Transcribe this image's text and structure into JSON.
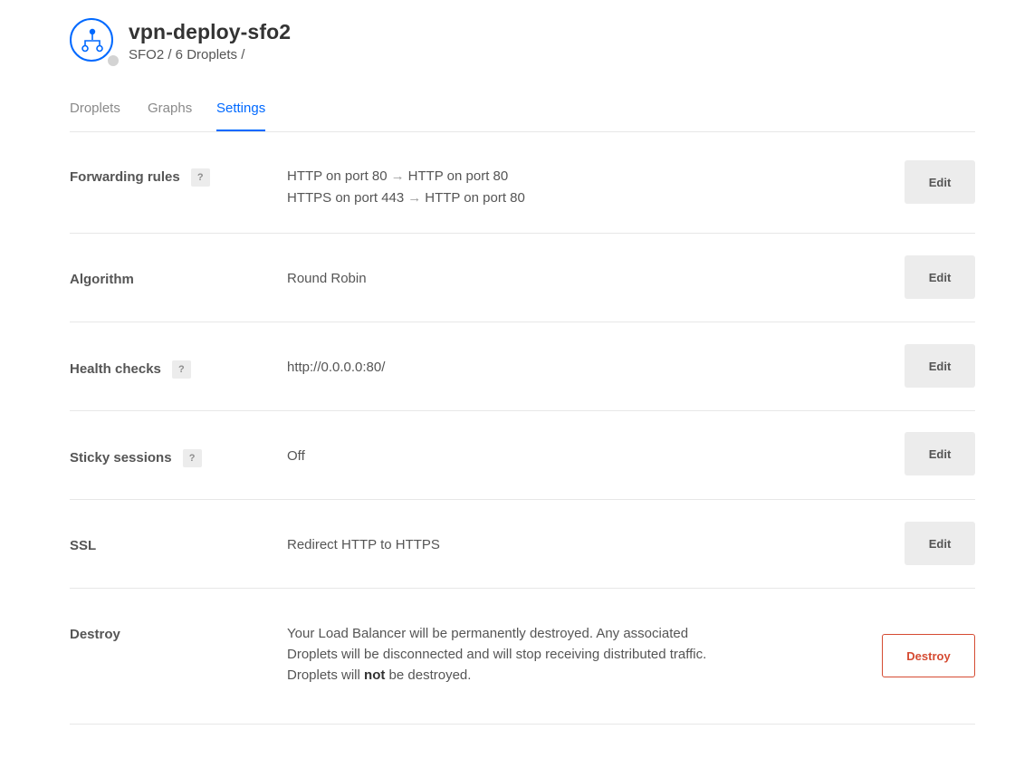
{
  "header": {
    "title": "vpn-deploy-sfo2",
    "subtitle": "SFO2 / 6 Droplets /",
    "icon": "load-balancer-icon",
    "status_color": "#d3d3d3"
  },
  "tabs": [
    {
      "label": "Droplets",
      "active": false
    },
    {
      "label": "Graphs",
      "active": false
    },
    {
      "label": "Settings",
      "active": true
    }
  ],
  "settings": {
    "forwarding": {
      "label": "Forwarding rules",
      "help": "?",
      "rules": [
        {
          "from": "HTTP on port 80",
          "arrow": "→",
          "to": "HTTP on port 80"
        },
        {
          "from": "HTTPS on port 443",
          "arrow": "→",
          "to": "HTTP on port 80"
        }
      ],
      "edit_label": "Edit"
    },
    "algorithm": {
      "label": "Algorithm",
      "value": "Round Robin",
      "edit_label": "Edit"
    },
    "health_checks": {
      "label": "Health checks",
      "help": "?",
      "value": "http://0.0.0.0:80/",
      "edit_label": "Edit"
    },
    "sticky_sessions": {
      "label": "Sticky sessions",
      "help": "?",
      "value": "Off",
      "edit_label": "Edit"
    },
    "ssl": {
      "label": "SSL",
      "value": "Redirect HTTP to HTTPS",
      "edit_label": "Edit"
    },
    "destroy": {
      "label": "Destroy",
      "text_before": "Your Load Balancer will be permanently destroyed. Any associated Droplets will be disconnected and will stop receiving distributed traffic. Droplets will ",
      "text_bold": "not",
      "text_after": " be destroyed.",
      "button_label": "Destroy"
    }
  },
  "colors": {
    "accent": "#0069ff",
    "danger": "#d54b32",
    "divider": "#e7e7e7",
    "button_bg": "#ececec"
  }
}
